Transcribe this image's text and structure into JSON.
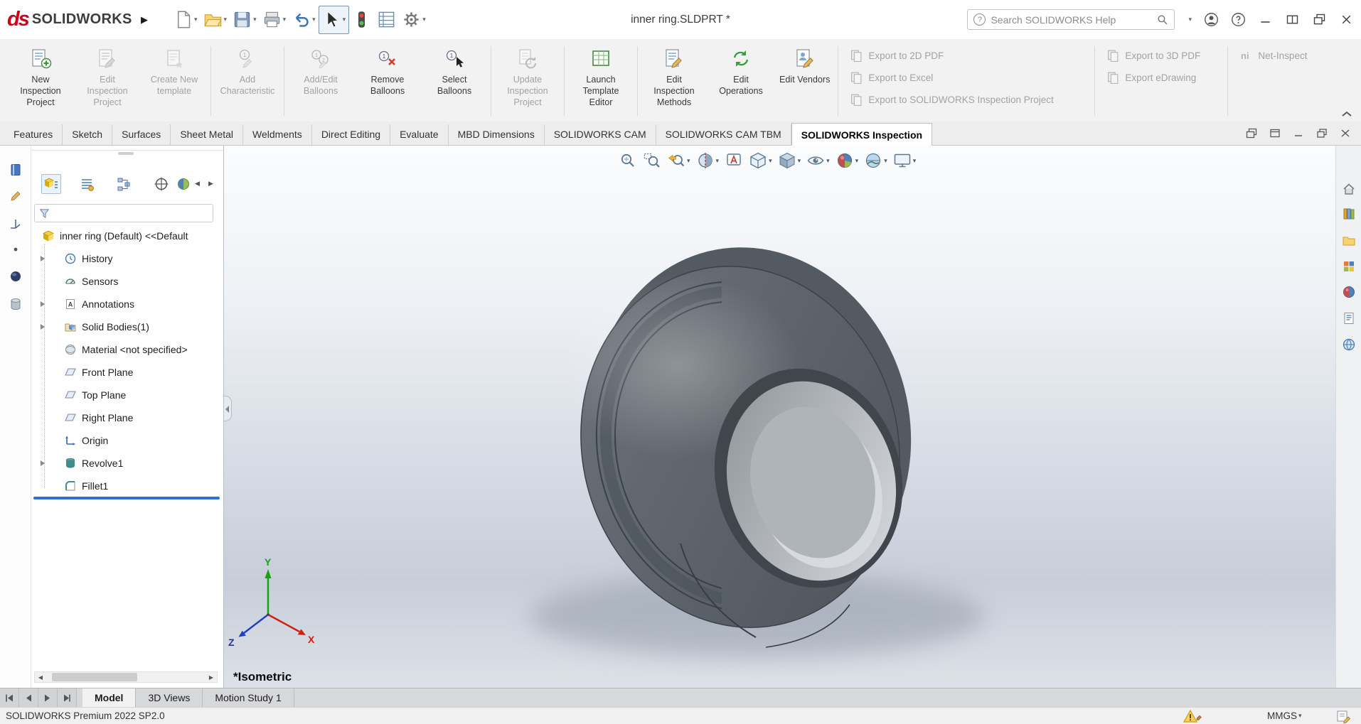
{
  "colors": {
    "logo_red": "#d0021b",
    "rollback_bar_blue": "#2f6fd0",
    "active_tool_border": "#7e96ad",
    "viewport_gradient_bottom": "#c7ced9"
  },
  "icons": {
    "caret_down": "▾",
    "flyout_right": "▶",
    "scroll_left": "◀",
    "scroll_right": "▶",
    "question_mark": "?"
  },
  "titlebar": {
    "logo_text": "SOLIDWORKS",
    "title": "inner ring.SLDPRT *",
    "search_placeholder": "Search SOLIDWORKS Help"
  },
  "ribbon": {
    "buttons": [
      {
        "label": "New Inspection Project",
        "enabled": true
      },
      {
        "label": "Edit Inspection Project",
        "enabled": false
      },
      {
        "label": "Create New template",
        "enabled": false
      },
      {
        "label": "Add Characteristic",
        "enabled": false
      },
      {
        "label": "Add/Edit Balloons",
        "enabled": false
      },
      {
        "label": "Remove Balloons",
        "enabled": true
      },
      {
        "label": "Select Balloons",
        "enabled": true
      },
      {
        "label": "Update Inspection Project",
        "enabled": false
      },
      {
        "label": "Launch Template Editor",
        "enabled": true
      },
      {
        "label": "Edit Inspection Methods",
        "enabled": true
      },
      {
        "label": "Edit Operations",
        "enabled": true
      },
      {
        "label": "Edit Vendors",
        "enabled": true
      }
    ],
    "export_buttons": [
      {
        "label": "Export to 2D PDF",
        "enabled": false
      },
      {
        "label": "Export to Excel",
        "enabled": false
      },
      {
        "label": "Export to SOLIDWORKS Inspection Project",
        "enabled": false
      },
      {
        "label": "Export to 3D PDF",
        "enabled": false
      },
      {
        "label": "Export eDrawing",
        "enabled": false
      },
      {
        "label": "Net-Inspect",
        "enabled": false
      }
    ],
    "net_inspect_glyph": "ni"
  },
  "command_tabs": {
    "items": [
      "Features",
      "Sketch",
      "Surfaces",
      "Sheet Metal",
      "Weldments",
      "Direct Editing",
      "Evaluate",
      "MBD Dimensions",
      "SOLIDWORKS CAM",
      "SOLIDWORKS CAM TBM",
      "SOLIDWORKS Inspection"
    ],
    "active": "SOLIDWORKS Inspection"
  },
  "feature_tree": {
    "root_label": "inner ring (Default) <<Default",
    "items": [
      {
        "label": "History",
        "expandable": true
      },
      {
        "label": "Sensors",
        "expandable": false
      },
      {
        "label": "Annotations",
        "expandable": true
      },
      {
        "label": "Solid Bodies(1)",
        "expandable": true
      },
      {
        "label": "Material <not specified>",
        "expandable": false
      },
      {
        "label": "Front Plane",
        "expandable": false
      },
      {
        "label": "Top Plane",
        "expandable": false
      },
      {
        "label": "Right Plane",
        "expandable": false
      },
      {
        "label": "Origin",
        "expandable": false
      },
      {
        "label": "Revolve1",
        "expandable": true
      },
      {
        "label": "Fillet1",
        "expandable": false
      }
    ]
  },
  "viewport": {
    "view_label": "*Isometric",
    "triad": {
      "x": "X",
      "y": "Y",
      "z": "Z"
    }
  },
  "model_tabs": {
    "items": [
      "Model",
      "3D Views",
      "Motion Study 1"
    ],
    "active": "Model"
  },
  "statusbar": {
    "left_text": "SOLIDWORKS Premium 2022 SP2.0",
    "units": "MMGS"
  }
}
